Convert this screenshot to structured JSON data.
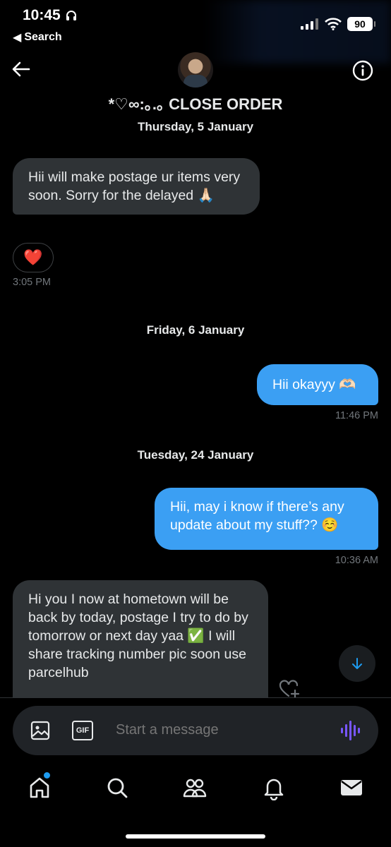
{
  "status": {
    "time": "10:45",
    "back_label": "Search",
    "battery": "90"
  },
  "header": {
    "title": "*♡∞:｡.｡ CLOSE ORDER"
  },
  "days": [
    "Thursday, 5 January",
    "Friday, 6 January",
    "Tuesday, 24 January"
  ],
  "messages": [
    {
      "direction": "in",
      "text": "Hii will make postage ur items very soon. Sorry for the delayed 🙏🏻",
      "time": "3:05 PM",
      "reaction": "❤️"
    },
    {
      "direction": "out",
      "text": "Hii okayyy 🫶🏻",
      "time": "11:46 PM"
    },
    {
      "direction": "out",
      "text": "Hii, may i know if there’s any update about my stuff?? ☺️",
      "time": "10:36 AM"
    },
    {
      "direction": "in",
      "text": "Hi you I now at hometown will be back by today, postage I try to do by tomorrow or next day yaa ✅ I will share tracking number pic soon use parcelhub"
    }
  ],
  "compose": {
    "placeholder": "Start a message",
    "gif_label": "GIF"
  },
  "colors": {
    "background": "#000000",
    "incoming_bubble": "#2f3336",
    "outgoing_bubble": "#3b9ff3",
    "accent": "#1d9bf0",
    "voice_accent": "#7856ff"
  },
  "icons": {
    "status": [
      "headphones-icon",
      "signal-icon",
      "wifi-icon",
      "battery-icon"
    ],
    "header": [
      "back-arrow-icon",
      "info-icon"
    ],
    "compose": [
      "image-icon",
      "gif-icon",
      "voice-icon"
    ],
    "nav": [
      "home-icon",
      "search-icon",
      "communities-icon",
      "notifications-icon",
      "messages-icon"
    ]
  }
}
